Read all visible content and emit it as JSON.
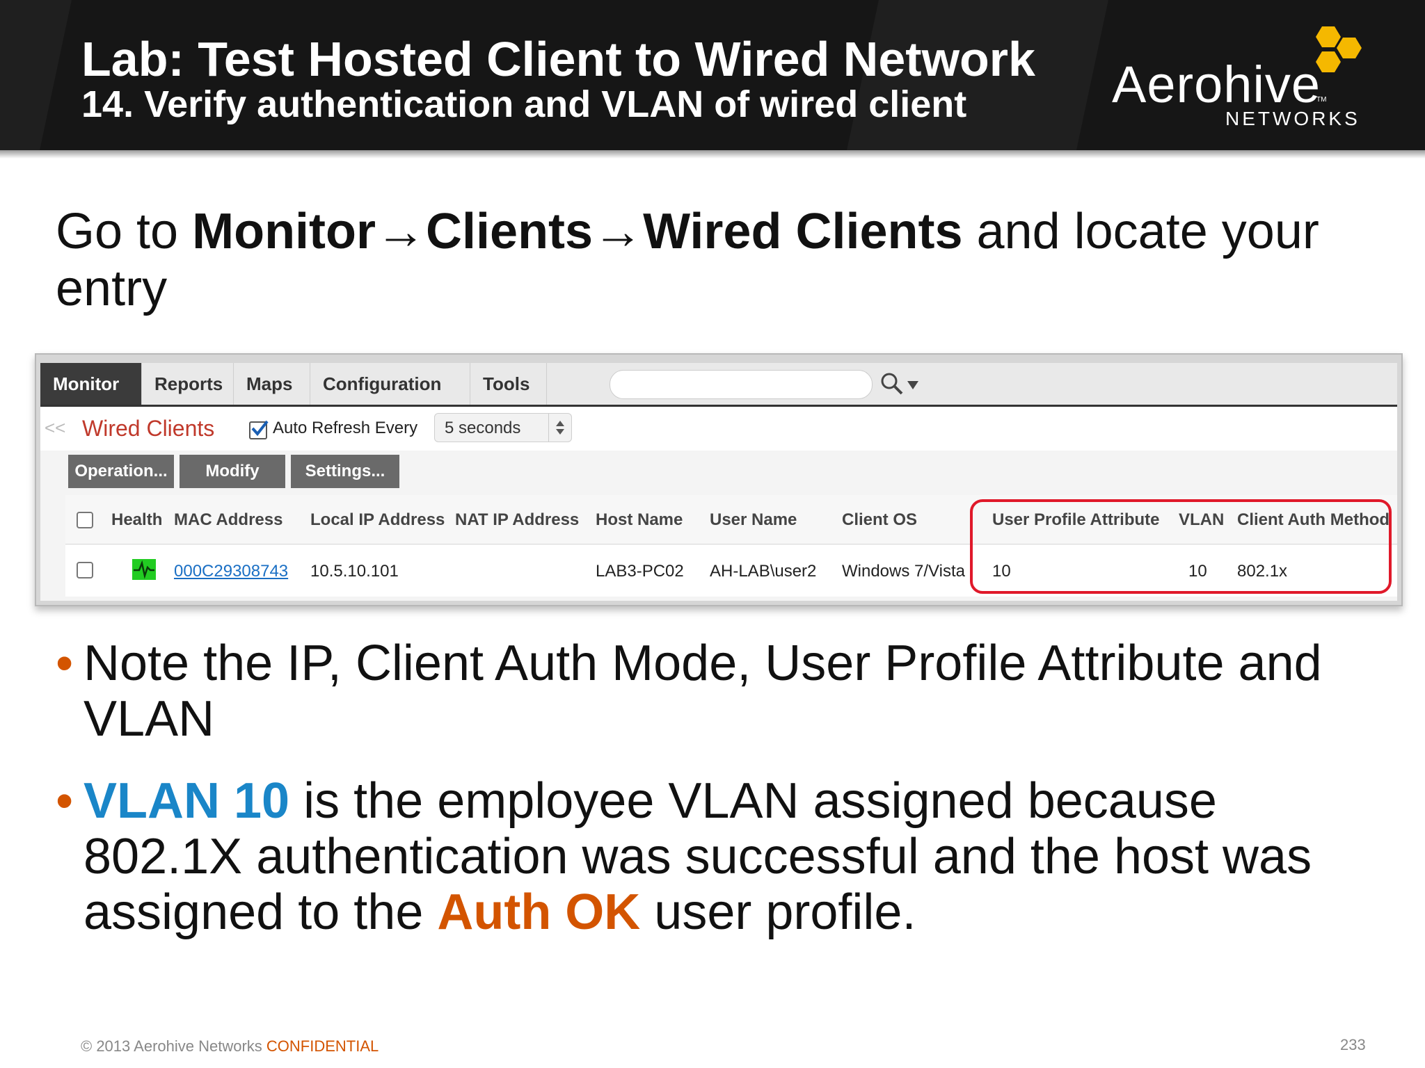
{
  "header": {
    "title": "Lab: Test Hosted Client to Wired Network",
    "subtitle": "14. Verify authentication and VLAN of wired client",
    "logo_word": "Aerohive",
    "logo_tm": "TM",
    "logo_sub": "NETWORKS"
  },
  "instruction": {
    "part1": "Go to ",
    "bold1": "Monitor",
    "arrow1": "→",
    "bold2": "Clients",
    "arrow2": "→",
    "bold3": "Wired Clients",
    "part2": " and locate your entry"
  },
  "app": {
    "tabs": [
      "Monitor",
      "Reports",
      "Maps",
      "Configuration",
      "Tools"
    ],
    "active_tab": "Monitor",
    "search_placeholder": "",
    "collapse_glyph": "<<",
    "page_name": "Wired Clients",
    "auto_refresh_checked": true,
    "auto_refresh_label": "Auto Refresh  Every",
    "refresh_interval": "5 seconds",
    "buttons": [
      "Operation...",
      "Modify",
      "Settings..."
    ],
    "columns": [
      "Health",
      "MAC Address",
      "Local IP Address",
      "NAT IP Address",
      "Host Name",
      "User Name",
      "Client OS",
      "User Profile Attribute",
      "VLAN",
      "Client Auth Method"
    ],
    "row": {
      "mac": "000C29308743",
      "local_ip": "10.5.10.101",
      "nat_ip": "",
      "host": "LAB3-PC02",
      "user": "AH-LAB\\user2",
      "os": "Windows 7/Vista",
      "upa": "10",
      "vlan": "10",
      "auth": "802.1x"
    }
  },
  "bullets": {
    "b1": "Note the IP, Client Auth Mode, User Profile Attribute and VLAN",
    "b2_highlight": "VLAN 10",
    "b2_mid": " is the employee VLAN assigned because 802.1X authentication was successful and the host was assigned to the ",
    "b2_orange": "Auth OK",
    "b2_end": " user profile."
  },
  "footer": {
    "copyright": "© 2013 Aerohive Networks ",
    "confidential": "CONFIDENTIAL",
    "page": "233"
  },
  "colors": {
    "accent_orange": "#d35400",
    "accent_blue": "#1a86c8",
    "highlight_red": "#e0192a",
    "logo_yellow": "#f5b800"
  }
}
